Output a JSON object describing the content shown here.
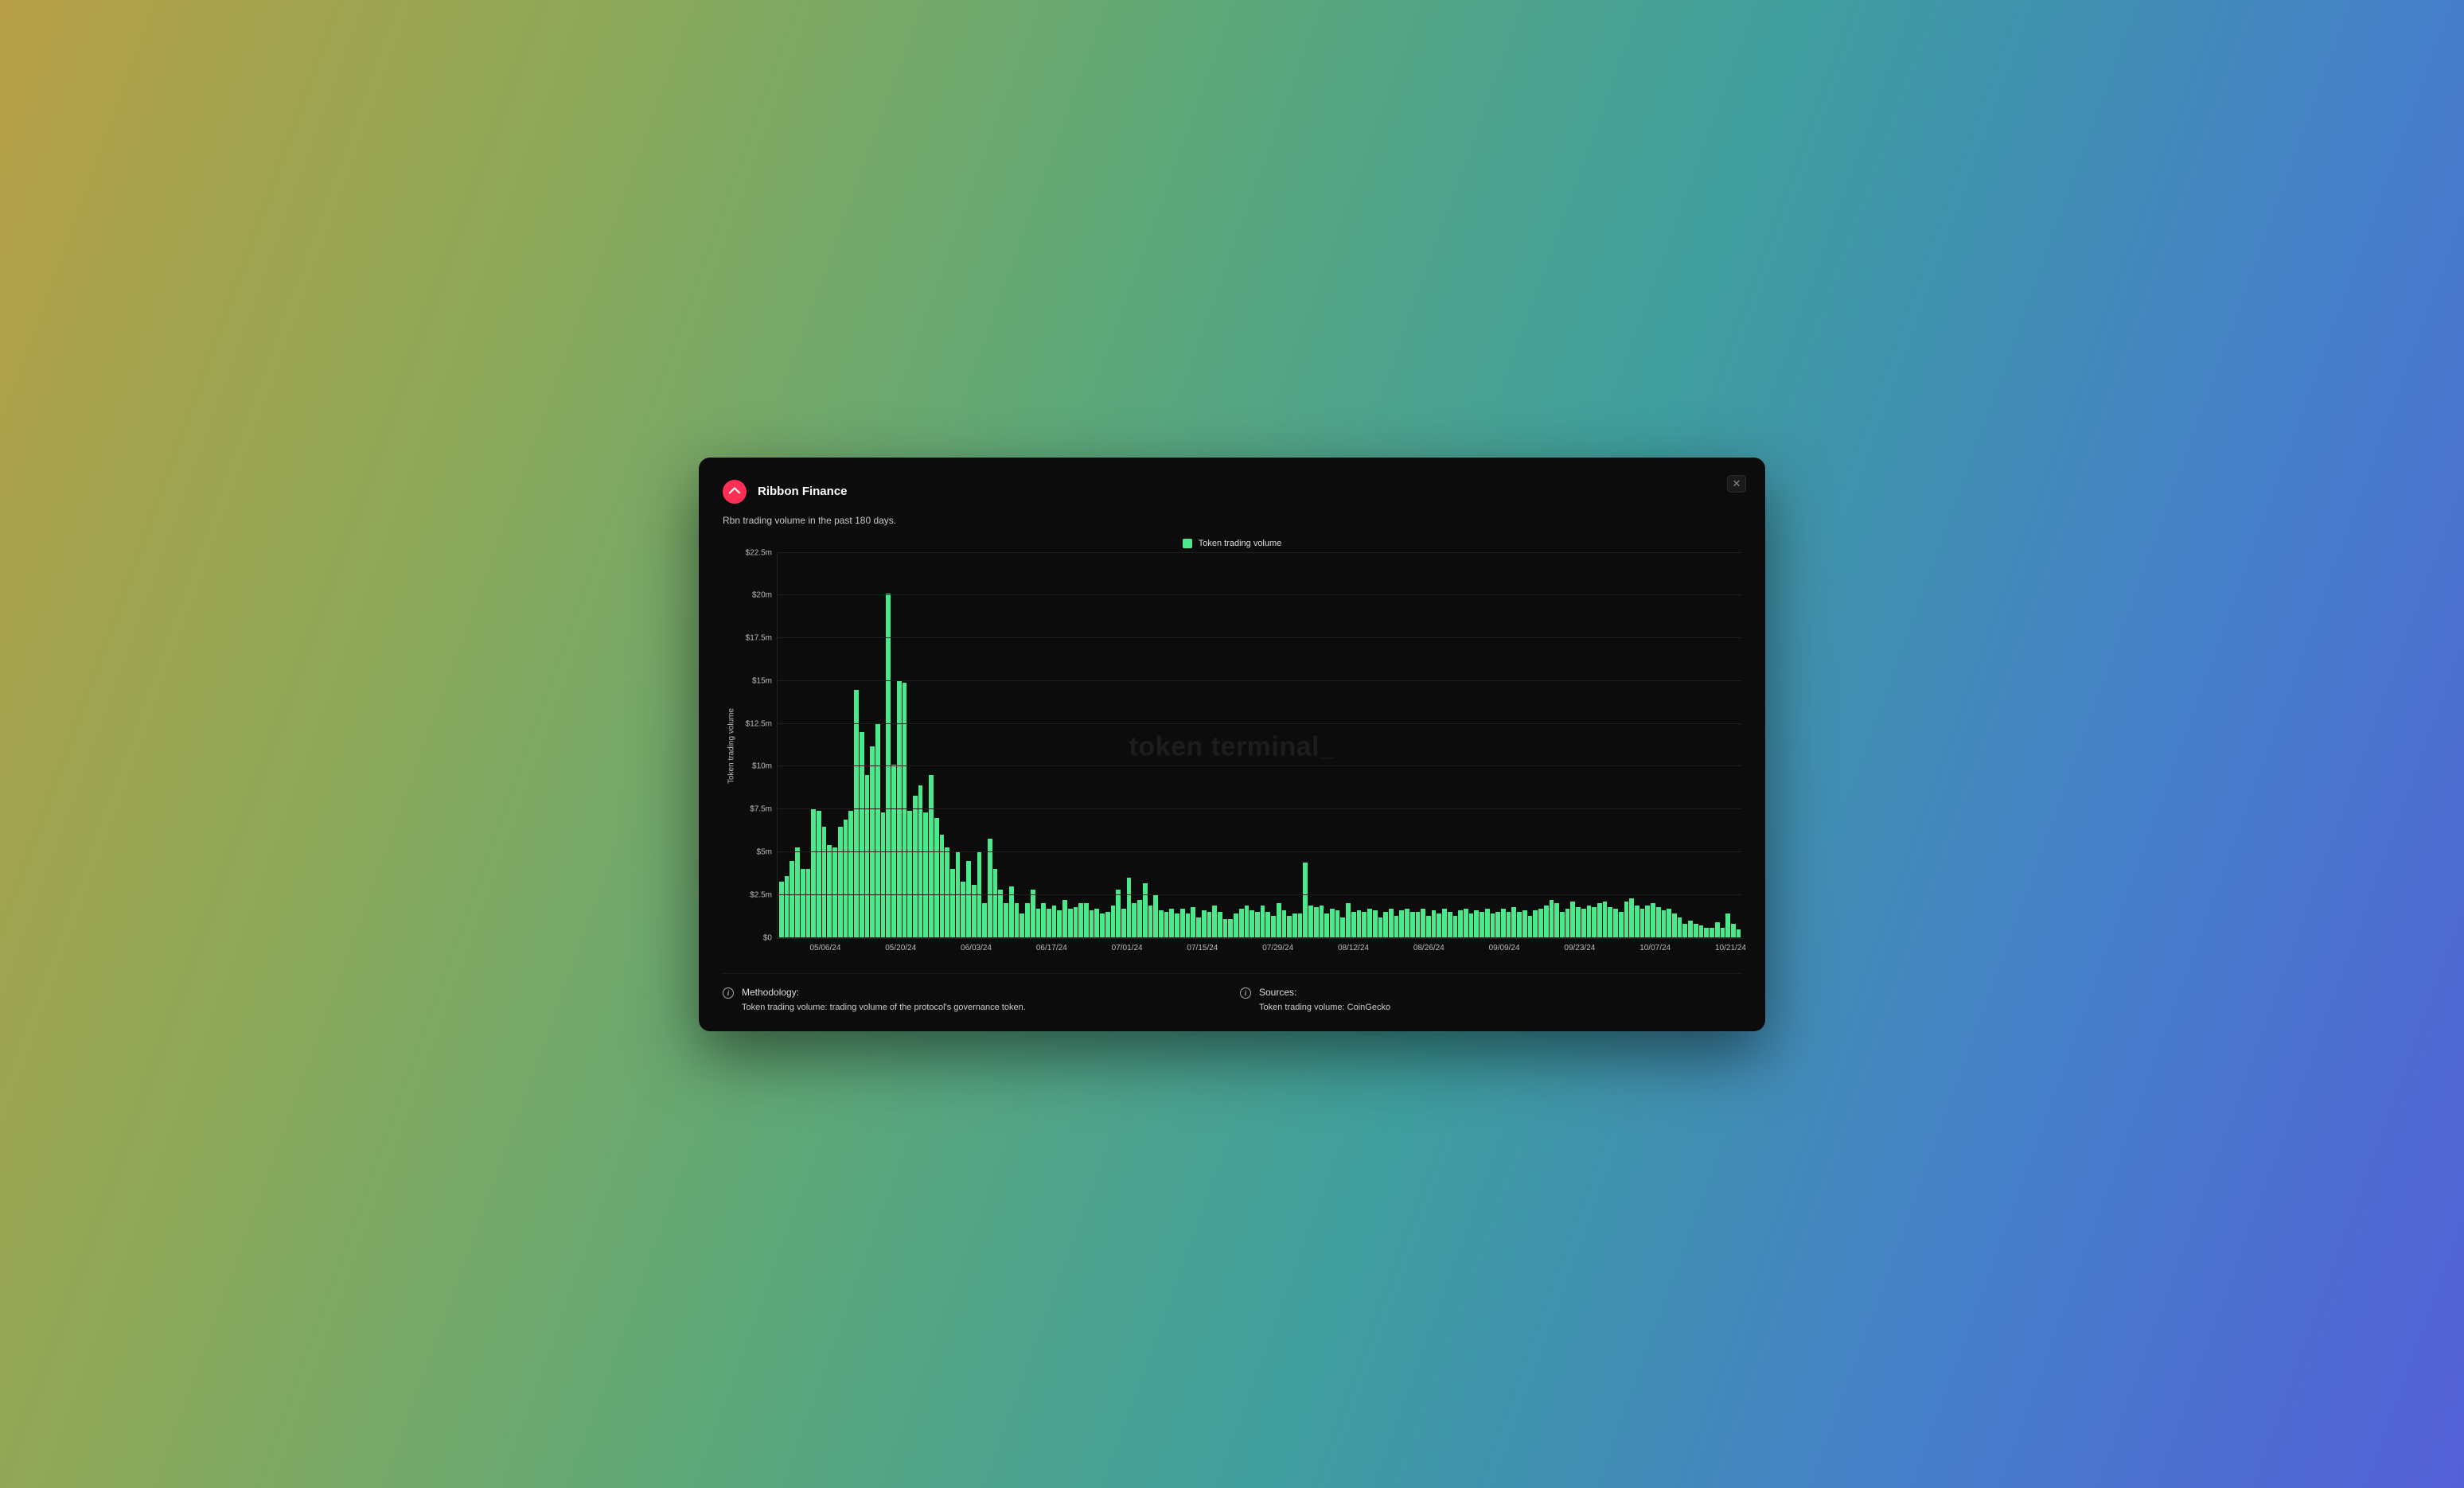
{
  "header": {
    "title": "Ribbon Finance",
    "logo_name": "ribbon-finance-logo"
  },
  "subtitle": "Rbn trading volume in the past 180 days.",
  "legend": {
    "label": "Token trading volume",
    "color": "#4ae98c"
  },
  "watermark": "token terminal_",
  "ylabel": "Token trading volume",
  "yticks": [
    "$0",
    "$2.5m",
    "$5m",
    "$7.5m",
    "$10m",
    "$12.5m",
    "$15m",
    "$17.5m",
    "$20m",
    "$22.5m"
  ],
  "xticks": [
    "05/06/24",
    "05/20/24",
    "06/03/24",
    "06/17/24",
    "07/01/24",
    "07/15/24",
    "07/29/24",
    "08/12/24",
    "08/26/24",
    "09/09/24",
    "09/23/24",
    "10/07/24",
    "10/21/24"
  ],
  "footer": {
    "methodology": {
      "heading": "Methodology:",
      "body": "Token trading volume: trading volume of the protocol's governance token."
    },
    "sources": {
      "heading": "Sources:",
      "body": "Token trading volume: CoinGecko"
    }
  },
  "chart_data": {
    "type": "bar",
    "title": "Rbn trading volume in the past 180 days.",
    "xlabel": "",
    "ylabel": "Token trading volume",
    "ylim": [
      0,
      22.5
    ],
    "y_unit": "$m",
    "x_start": "2024-04-27",
    "x_end": "2024-10-23",
    "series": [
      {
        "name": "Token trading volume",
        "color": "#4ae98c",
        "values": [
          3.3,
          3.6,
          4.5,
          5.3,
          4.0,
          4.0,
          7.5,
          7.4,
          6.5,
          5.4,
          5.3,
          6.5,
          6.9,
          7.4,
          14.5,
          12.0,
          9.5,
          11.2,
          12.5,
          7.3,
          20.1,
          10.1,
          15.0,
          14.9,
          7.4,
          8.3,
          8.9,
          7.3,
          9.5,
          7.0,
          6.0,
          5.3,
          4.0,
          5.0,
          3.3,
          4.5,
          3.1,
          5.0,
          2.0,
          5.8,
          4.0,
          2.8,
          2.0,
          3.0,
          2.0,
          1.4,
          2.0,
          2.8,
          1.7,
          2.0,
          1.7,
          1.9,
          1.6,
          2.2,
          1.7,
          1.8,
          2.0,
          2.0,
          1.6,
          1.7,
          1.4,
          1.5,
          1.9,
          2.8,
          1.7,
          3.5,
          2.0,
          2.2,
          3.2,
          1.9,
          2.5,
          1.6,
          1.5,
          1.7,
          1.4,
          1.7,
          1.4,
          1.8,
          1.2,
          1.6,
          1.5,
          1.9,
          1.5,
          1.1,
          1.1,
          1.4,
          1.7,
          1.9,
          1.6,
          1.5,
          1.9,
          1.5,
          1.3,
          2.0,
          1.6,
          1.3,
          1.4,
          1.4,
          4.4,
          1.9,
          1.8,
          1.9,
          1.4,
          1.7,
          1.6,
          1.2,
          2.0,
          1.5,
          1.6,
          1.5,
          1.7,
          1.6,
          1.2,
          1.5,
          1.7,
          1.3,
          1.6,
          1.7,
          1.5,
          1.5,
          1.7,
          1.3,
          1.6,
          1.4,
          1.7,
          1.5,
          1.3,
          1.6,
          1.7,
          1.4,
          1.6,
          1.5,
          1.7,
          1.4,
          1.5,
          1.7,
          1.5,
          1.8,
          1.5,
          1.6,
          1.3,
          1.6,
          1.7,
          1.9,
          2.2,
          2.0,
          1.5,
          1.7,
          2.1,
          1.8,
          1.7,
          1.9,
          1.8,
          2.0,
          2.1,
          1.8,
          1.7,
          1.5,
          2.1,
          2.3,
          1.9,
          1.7,
          1.9,
          2.0,
          1.8,
          1.6,
          1.7,
          1.4,
          1.2,
          0.8,
          1.0,
          0.8,
          0.7,
          0.6,
          0.6,
          0.9,
          0.6,
          1.4,
          0.8,
          0.5
        ]
      }
    ],
    "x_tick_labels": [
      "05/06/24",
      "05/20/24",
      "06/03/24",
      "06/17/24",
      "07/01/24",
      "07/15/24",
      "07/29/24",
      "08/12/24",
      "08/26/24",
      "09/09/24",
      "09/23/24",
      "10/07/24",
      "10/21/24"
    ]
  }
}
